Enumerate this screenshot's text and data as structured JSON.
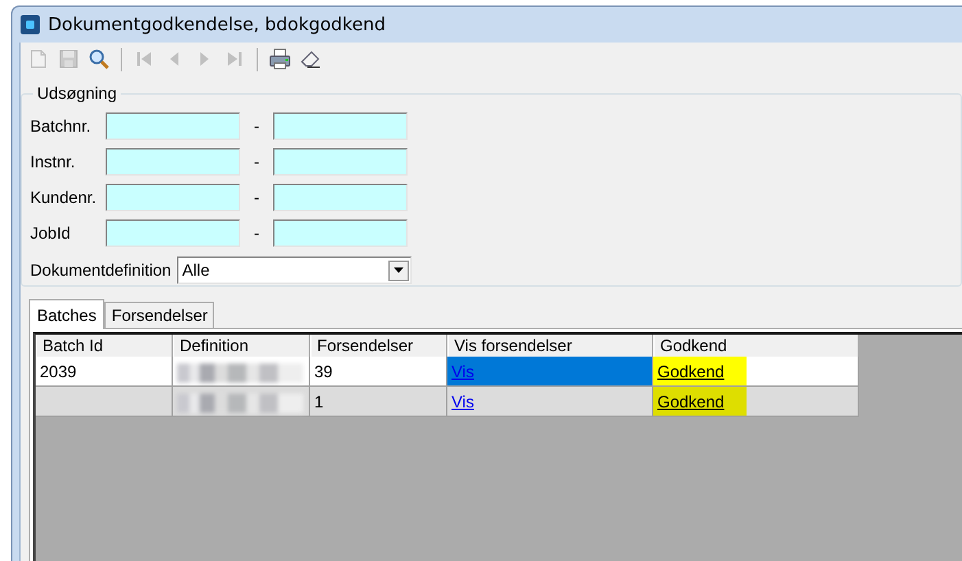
{
  "window": {
    "title": "Dokumentgodkendelse, bdokgodkend"
  },
  "toolbar": [
    {
      "kind": "new",
      "disabled": true
    },
    {
      "kind": "save",
      "disabled": true
    },
    {
      "kind": "search",
      "disabled": false
    },
    {
      "kind": "separator"
    },
    {
      "kind": "first",
      "disabled": true
    },
    {
      "kind": "prev",
      "disabled": true
    },
    {
      "kind": "next",
      "disabled": true
    },
    {
      "kind": "last",
      "disabled": true
    },
    {
      "kind": "separator"
    },
    {
      "kind": "print",
      "disabled": false
    },
    {
      "kind": "eraser",
      "disabled": false
    }
  ],
  "search": {
    "title": "Udsøgning",
    "ranges": [
      {
        "label": "Batchnr.",
        "separator": "-"
      },
      {
        "label": "Instnr.",
        "separator": "-"
      },
      {
        "label": "Kundenr.",
        "separator": "-"
      },
      {
        "label": "JobId",
        "separator": "-"
      }
    ],
    "dropdown": {
      "label": "Dokumentdefinition",
      "value": "Alle"
    }
  },
  "tabs": [
    {
      "label": "Batches",
      "selected": true
    },
    {
      "label": "Forsendelser",
      "selected": false
    }
  ],
  "table": {
    "columns": [
      "Batch Id",
      "Definition",
      "Forsendelser",
      "Vis forsendelser",
      "Godkend"
    ],
    "rows": [
      {
        "batch_id": "2039",
        "definition_blurred": true,
        "forsendelser": "39",
        "vis": "Vis",
        "godkend": "Godkend",
        "selected": true,
        "highlighted": true
      },
      {
        "batch_id": "",
        "definition_blurred": true,
        "forsendelser": "1",
        "vis": "Vis",
        "godkend": "Godkend",
        "selected": false,
        "highlighted": true
      }
    ]
  }
}
